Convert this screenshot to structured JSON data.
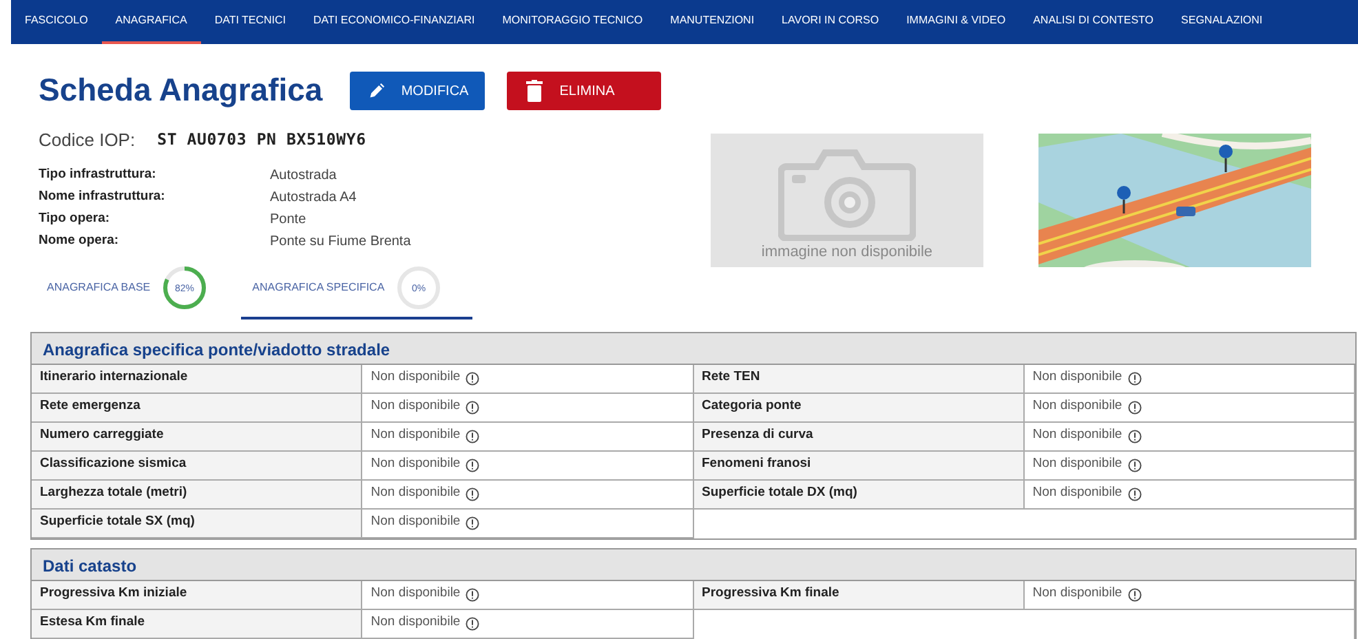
{
  "nav": [
    {
      "label": "FASCICOLO",
      "selected": false
    },
    {
      "label": "ANAGRAFICA",
      "selected": true
    },
    {
      "label": "DATI TECNICI",
      "selected": false
    },
    {
      "label": "DATI ECONOMICO-FINANZIARI",
      "selected": false
    },
    {
      "label": "MONITORAGGIO TECNICO",
      "selected": false
    },
    {
      "label": "MANUTENZIONI",
      "selected": false
    },
    {
      "label": "LAVORI IN CORSO",
      "selected": false
    },
    {
      "label": "IMMAGINI & VIDEO",
      "selected": false
    },
    {
      "label": "ANALISI DI CONTESTO",
      "selected": false
    },
    {
      "label": "SEGNALAZIONI",
      "selected": false
    }
  ],
  "title": "Scheda Anagrafica",
  "buttons": [
    {
      "kind": "edit",
      "label": "MODIFICA"
    },
    {
      "kind": "delete",
      "label": "ELIMINA"
    }
  ],
  "code": {
    "label": "Codice IOP:",
    "value": "ST AU0703 PN BX510WY6"
  },
  "details": [
    {
      "label": "Tipo infrastruttura:",
      "value": "Autostrada"
    },
    {
      "label": "Nome infrastruttura:",
      "value": "Autostrada A4"
    },
    {
      "label": "Tipo opera:",
      "value": "Ponte"
    },
    {
      "label": "Nome opera:",
      "value": "Ponte su Fiume Brenta"
    }
  ],
  "image_placeholder": "immagine non disponibile",
  "tabs": [
    {
      "label": "ANAGRAFICA BASE",
      "selected": false,
      "level": 0.82,
      "reading": "82%"
    },
    {
      "label": "ANAGRAFICA SPECIFICA",
      "selected": true,
      "level": 0,
      "reading": "0%"
    }
  ],
  "sections": [
    {
      "title": "Anagrafica specifica ponte/viadotto stradale",
      "rows": [
        [
          {
            "label": "Itinerario internazionale",
            "value": "Non disponibile"
          },
          {
            "label": "Rete TEN",
            "value": "Non disponibile"
          }
        ],
        [
          {
            "label": "Rete emergenza",
            "value": "Non disponibile"
          },
          {
            "label": "Categoria ponte",
            "value": "Non disponibile"
          }
        ],
        [
          {
            "label": "Numero carreggiate",
            "value": "Non disponibile"
          },
          {
            "label": "Presenza di curva",
            "value": "Non disponibile"
          }
        ],
        [
          {
            "label": "Classificazione sismica",
            "value": "Non disponibile"
          },
          {
            "label": "Fenomeni franosi",
            "value": "Non disponibile"
          }
        ],
        [
          {
            "label": "Larghezza totale (metri)",
            "value": "Non disponibile"
          },
          {
            "label": "Superficie totale DX (mq)",
            "value": "Non disponibile"
          }
        ],
        [
          {
            "label": "Superficie totale SX (mq)",
            "value": "Non disponibile"
          }
        ]
      ]
    },
    {
      "title": "Dati catasto",
      "rows": [
        [
          {
            "label": "Progressiva Km iniziale",
            "value": "Non disponibile"
          },
          {
            "label": "Progressiva Km finale",
            "value": "Non disponibile"
          }
        ],
        [
          {
            "label": "Estesa Km finale",
            "value": "Non disponibile"
          }
        ]
      ]
    }
  ]
}
